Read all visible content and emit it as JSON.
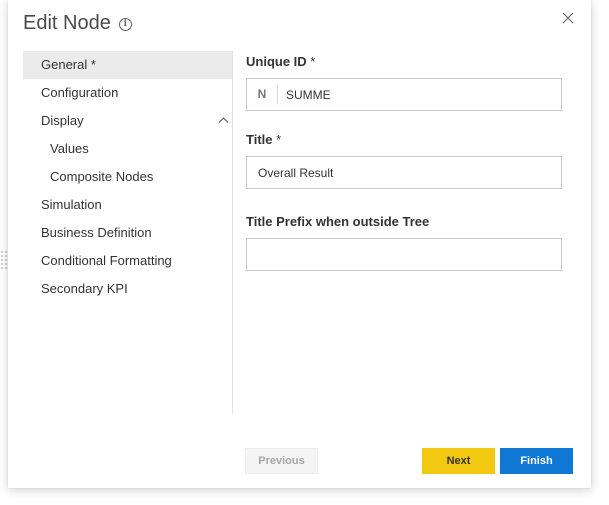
{
  "dialog": {
    "title": "Edit Node",
    "info_icon_glyph": "i"
  },
  "nav": {
    "items": [
      {
        "label": "General *"
      },
      {
        "label": "Configuration"
      },
      {
        "label": "Display"
      },
      {
        "label": "Values"
      },
      {
        "label": "Composite Nodes"
      },
      {
        "label": "Simulation"
      },
      {
        "label": "Business Definition"
      },
      {
        "label": "Conditional Formatting"
      },
      {
        "label": "Secondary KPI"
      }
    ]
  },
  "form": {
    "unique_id": {
      "label": "Unique ID",
      "required_mark": "*",
      "prefix": "N",
      "value": "SUMME"
    },
    "title": {
      "label": "Title",
      "required_mark": "*",
      "value": "Overall Result"
    },
    "title_prefix": {
      "label": "Title Prefix when outside Tree",
      "value": ""
    }
  },
  "footer": {
    "previous_label": "Previous",
    "next_label": "Next",
    "finish_label": "Finish"
  },
  "colors": {
    "next_button": "#f2c811",
    "finish_button": "#0f78d4",
    "active_nav": "#ebebeb"
  }
}
